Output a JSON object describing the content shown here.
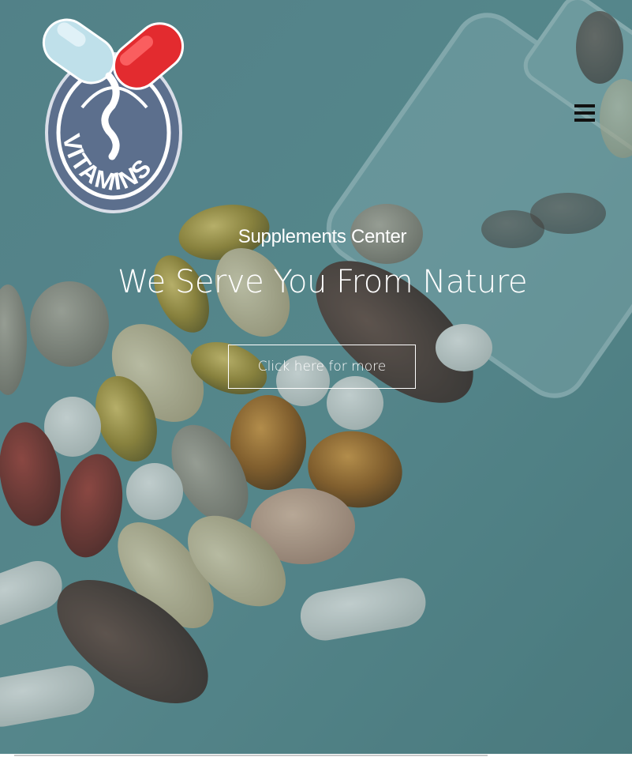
{
  "brand": {
    "logo_text": "VITAMINS",
    "icon": "pill-capsule-logo"
  },
  "nav": {
    "menu_icon": "hamburger-menu-icon"
  },
  "hero": {
    "subtitle": "Supplements Center",
    "headline": "We Serve You From Nature",
    "cta_label": "Click here for more",
    "background": "pills-and-supplements-photo"
  },
  "colors": {
    "overlay": "#4f7e83",
    "logo_ring": "#5c6f8d",
    "capsule_red": "#e32b2f",
    "capsule_blue": "#bfe0ea",
    "text": "#ffffff",
    "menu_icon": "#111111"
  }
}
